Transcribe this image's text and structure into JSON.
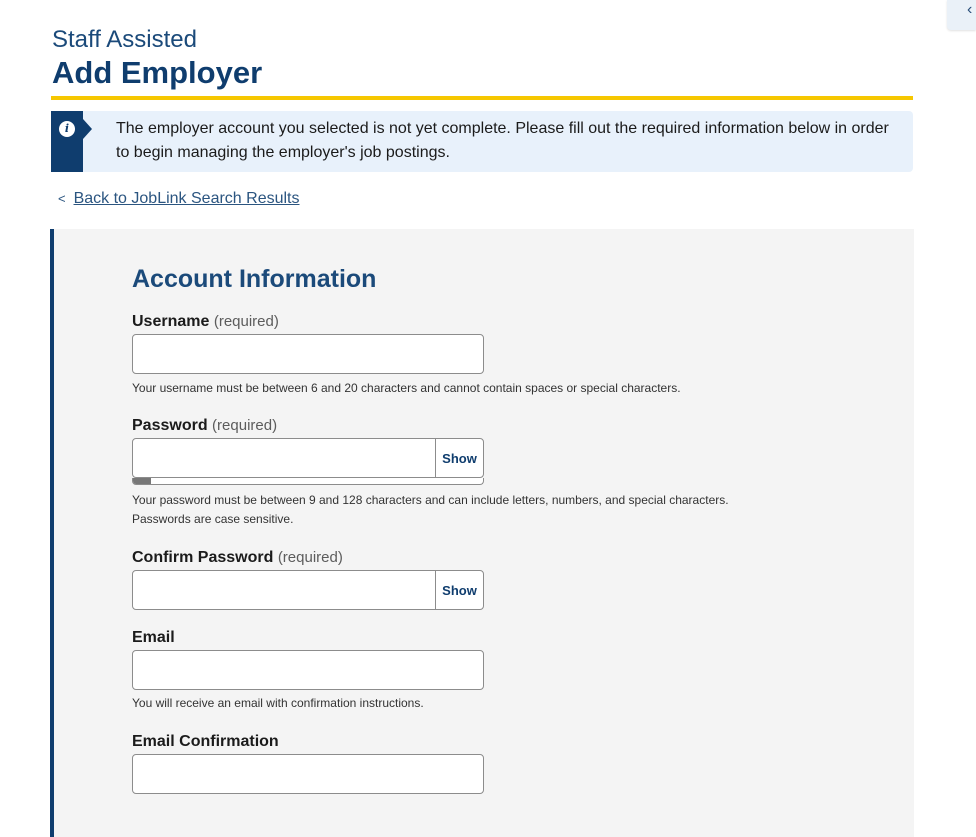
{
  "collapse_icon": "chevron-left",
  "header": {
    "subtitle": "Staff Assisted",
    "title": "Add Employer"
  },
  "alert": {
    "icon": "info-icon",
    "message": "The employer account you selected is not yet complete. Please fill out the required information below in order to begin managing the employer's job postings."
  },
  "back_link": {
    "chevron": "<",
    "label": "Back to JobLink Search Results"
  },
  "form": {
    "section_title": "Account Information",
    "username": {
      "label": "Username",
      "required": "(required)",
      "value": "",
      "help": "Your username must be between 6 and 20 characters and cannot contain spaces or special characters."
    },
    "password": {
      "label": "Password",
      "required": "(required)",
      "value": "",
      "show_label": "Show",
      "strength_fraction": 0.05,
      "help_line1": "Your password must be between 9 and 128 characters and can include letters, numbers, and special characters.",
      "help_line2": "Passwords are case sensitive."
    },
    "confirm_password": {
      "label": "Confirm Password",
      "required": "(required)",
      "value": "",
      "show_label": "Show"
    },
    "email": {
      "label": "Email",
      "value": "",
      "help": "You will receive an email with confirmation instructions."
    },
    "email_confirmation": {
      "label": "Email Confirmation",
      "value": ""
    }
  },
  "colors": {
    "brand_navy": "#0f3d6e",
    "accent_gold": "#f6c700",
    "alert_bg": "#e8f1fb",
    "panel_bg": "#f4f4f4"
  }
}
